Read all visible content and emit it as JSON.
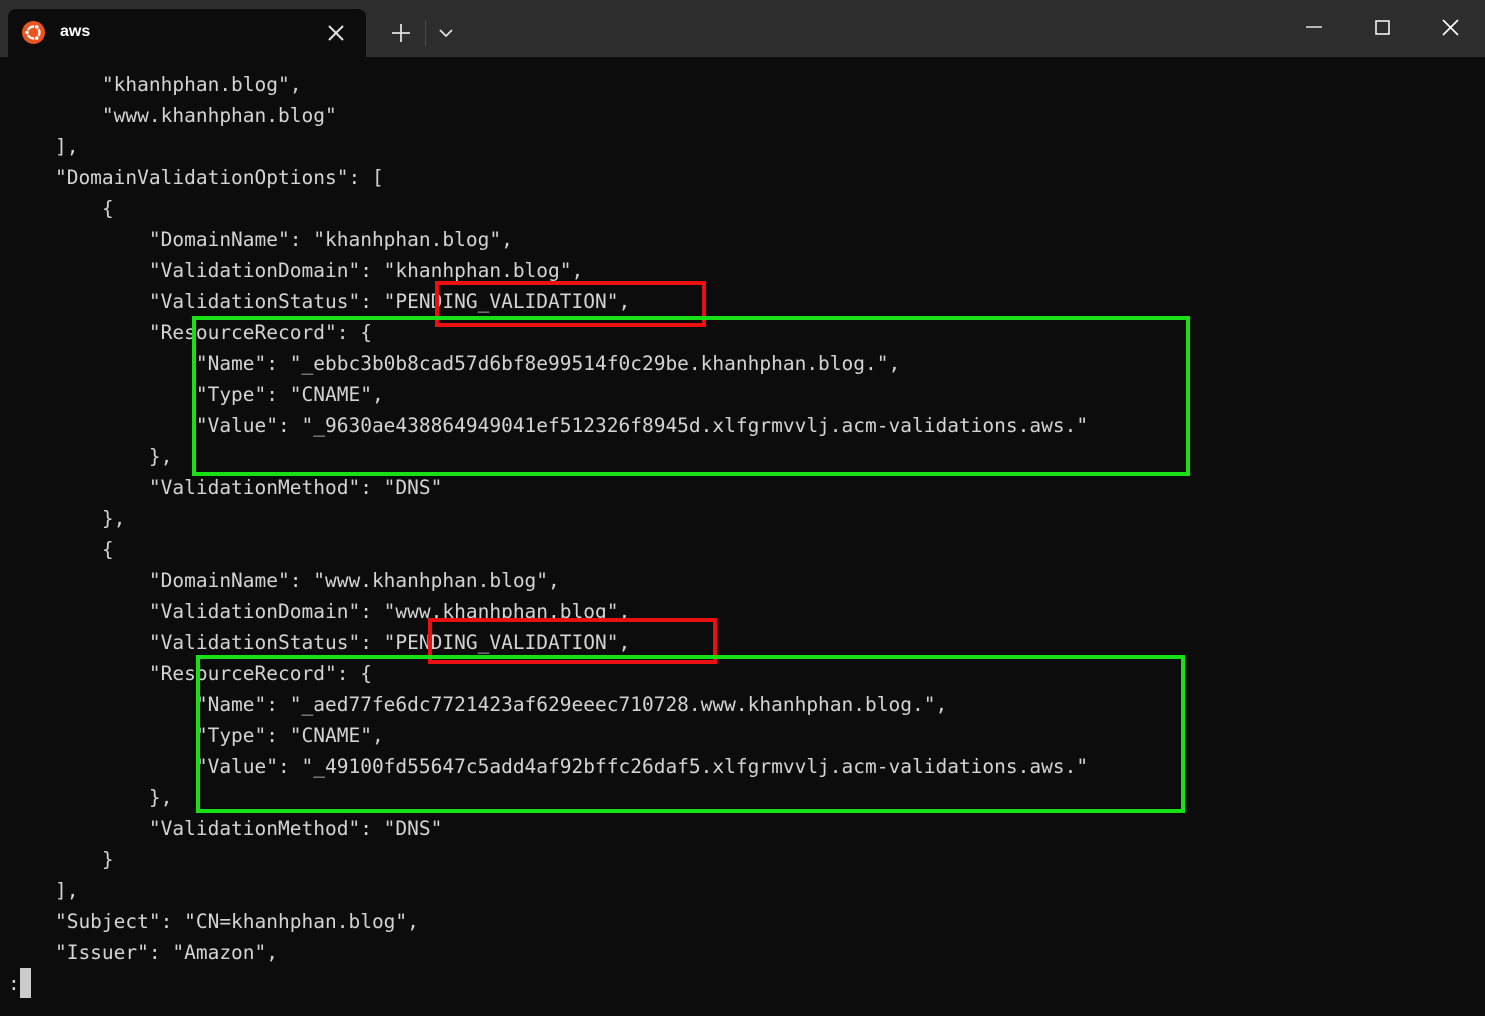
{
  "window": {
    "tab_title": "aws",
    "tab_icon": "ubuntu-icon",
    "accent_color": "#e95420"
  },
  "terminal": {
    "lines": [
      "        \"khanhphan.blog\",",
      "        \"www.khanhphan.blog\"",
      "    ],",
      "    \"DomainValidationOptions\": [",
      "        {",
      "            \"DomainName\": \"khanhphan.blog\",",
      "            \"ValidationDomain\": \"khanhphan.blog\",",
      "            \"ValidationStatus\": \"PENDING_VALIDATION\",",
      "            \"ResourceRecord\": {",
      "                \"Name\": \"_ebbc3b0b8cad57d6bf8e99514f0c29be.khanhphan.blog.\",",
      "                \"Type\": \"CNAME\",",
      "                \"Value\": \"_9630ae438864949041ef512326f8945d.xlfgrmvvlj.acm-validations.aws.\"",
      "            },",
      "            \"ValidationMethod\": \"DNS\"",
      "        },",
      "        {",
      "            \"DomainName\": \"www.khanhphan.blog\",",
      "            \"ValidationDomain\": \"www.khanhphan.blog\",",
      "            \"ValidationStatus\": \"PENDING_VALIDATION\",",
      "            \"ResourceRecord\": {",
      "                \"Name\": \"_aed77fe6dc7721423af629eeec710728.www.khanhphan.blog.\",",
      "                \"Type\": \"CNAME\",",
      "                \"Value\": \"_49100fd55647c5add4af92bffc26daf5.xlfgrmvvlj.acm-validations.aws.\"",
      "            },",
      "            \"ValidationMethod\": \"DNS\"",
      "        }",
      "    ],",
      "    \"Subject\": \"CN=khanhphan.blog\",",
      "    \"Issuer\": \"Amazon\","
    ],
    "prompt": ":"
  },
  "highlights": {
    "status_color": "#e81010",
    "record_color": "#16e016"
  }
}
